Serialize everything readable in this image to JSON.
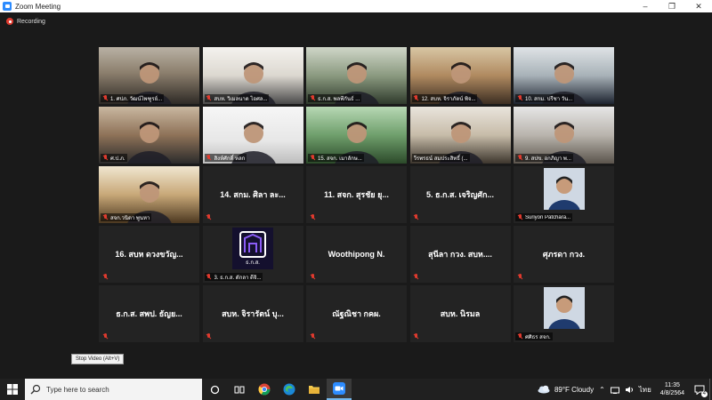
{
  "window": {
    "title": "Zoom Meeting",
    "recording_label": "Recording",
    "controls": [
      "minimize",
      "maximize",
      "close"
    ]
  },
  "tiles": [
    {
      "label": "1. ศปภ. วัฒน์ไพฑูรย์...",
      "video": true,
      "muted": true,
      "active": false
    },
    {
      "label": "สบห. วิเมลนาด ไอศล...",
      "video": true,
      "muted": true,
      "active": false
    },
    {
      "label": "ธ.ก.ส. พลพีกันธ์ ...",
      "video": true,
      "muted": true,
      "active": false
    },
    {
      "label": "12. สบห. จิราภัตน์ พิจ...",
      "video": true,
      "muted": true,
      "active": true
    },
    {
      "label": "10. สกม. ปรีชา วัน...",
      "video": true,
      "muted": true,
      "active": false
    },
    {
      "label": "ศ.ป.ภ.",
      "video": true,
      "muted": true,
      "active": false
    },
    {
      "label": "สิงห์ศักดิ์ หลก",
      "video": true,
      "muted": true,
      "active": false
    },
    {
      "label": "15. สจก. เมาลักษ...",
      "video": true,
      "muted": true,
      "active": false
    },
    {
      "label": "วีรพรธน์ สมประสิทธิ์ (...",
      "video": true,
      "muted": false,
      "active": false
    },
    {
      "label": "9. สปข. อกภิญา พ...",
      "video": true,
      "muted": true,
      "active": false
    },
    {
      "label": "สจก.วนิดา พูนหา",
      "video": true,
      "muted": true,
      "active": false
    },
    {
      "label": "14. สกม. ศิลา ละ...",
      "video": false,
      "muted": true,
      "active": false
    },
    {
      "label": "11. สจก. สุรชัย ยุ...",
      "video": false,
      "muted": true,
      "active": false
    },
    {
      "label": "5. ธ.ก.ส. เจริญศัก...",
      "video": false,
      "muted": true,
      "active": false
    },
    {
      "label": "Suriyon Patchara...",
      "video": false,
      "muted": true,
      "active": false,
      "avatar": true
    },
    {
      "label": "16. สบห ดวงขวัญ...",
      "video": false,
      "muted": true,
      "active": false
    },
    {
      "label": "3. ธ.ก.ส. ดักลา ดีจิ...",
      "video": false,
      "muted": true,
      "active": false,
      "logo": true,
      "logo_text": "ธ.ก.ส."
    },
    {
      "label": "Woothipong N.",
      "video": false,
      "muted": true,
      "active": false
    },
    {
      "label": "สุนีลา กวง. สบห....",
      "video": false,
      "muted": true,
      "active": false
    },
    {
      "label": "ศุภรดา กวง.",
      "video": false,
      "muted": true,
      "active": false
    },
    {
      "label": "ธ.ก.ส. สพป. ธัญย...",
      "video": false,
      "muted": true,
      "active": false
    },
    {
      "label": "สบห. จิรารัตน์ บุ...",
      "video": false,
      "muted": true,
      "active": false
    },
    {
      "label": "ณัฐณิชา กคผ.",
      "video": false,
      "muted": true,
      "active": false
    },
    {
      "label": "สบห. นิรมล",
      "video": false,
      "muted": true,
      "active": false
    },
    {
      "label": "ศศิธร สจก.",
      "video": false,
      "muted": true,
      "active": false,
      "avatar": true
    }
  ],
  "tooltip": "Stop Video (Alt+V)",
  "taskbar": {
    "search_placeholder": "Type here to search",
    "weather": "89°F  Cloudy",
    "language": "ไทย",
    "time": "11:35",
    "date": "4/8/2564",
    "notification_count": "4"
  },
  "colors": {
    "active_speaker": "#c9e84a",
    "muted_icon": "#e03a2e",
    "zoom_blue": "#2d8cff"
  }
}
